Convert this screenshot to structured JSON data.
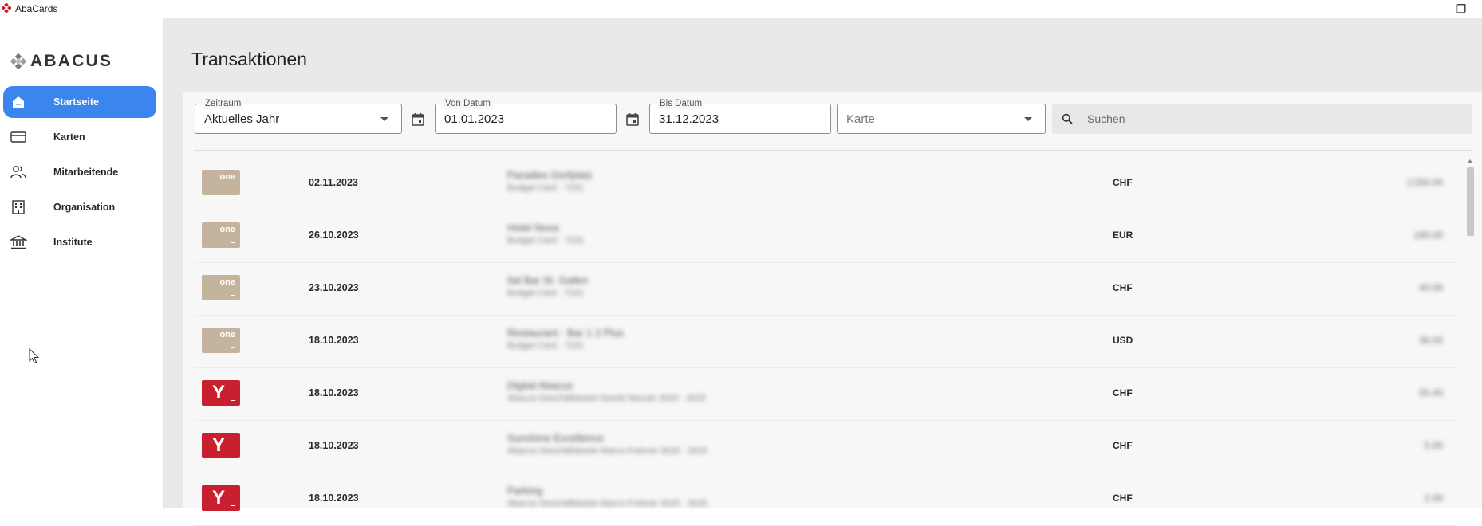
{
  "window": {
    "title": "AbaCards",
    "minimize_glyph": "–",
    "restore_glyph": "❐"
  },
  "sidebar": {
    "logo_text": "ABACUS",
    "items": [
      {
        "label": "Startseite",
        "icon": "home-icon",
        "active": true
      },
      {
        "label": "Karten",
        "icon": "card-icon",
        "active": false
      },
      {
        "label": "Mitarbeitende",
        "icon": "people-icon",
        "active": false
      },
      {
        "label": "Organisation",
        "icon": "building-icon",
        "active": false
      },
      {
        "label": "Institute",
        "icon": "bank-icon",
        "active": false
      }
    ]
  },
  "page": {
    "title": "Transaktionen"
  },
  "filters": {
    "zeitraum": {
      "label": "Zeitraum",
      "value": "Aktuelles Jahr"
    },
    "von_datum": {
      "label": "Von Datum",
      "value": "01.01.2023"
    },
    "bis_datum": {
      "label": "Bis Datum",
      "value": "31.12.2023"
    },
    "karte": {
      "placeholder": "Karte"
    },
    "search": {
      "placeholder": "Suchen"
    }
  },
  "card_labels": {
    "beige": "one",
    "red": "Y"
  },
  "transactions": [
    {
      "card": "beige",
      "date": "02.11.2023",
      "merchant": "Paradies Dorfplatz",
      "merchant_sub": "Budget Card · 7231",
      "currency": "CHF",
      "amount": "1'250.00"
    },
    {
      "card": "beige",
      "date": "26.10.2023",
      "merchant": "Hotel Nova",
      "merchant_sub": "Budget Card · 7231",
      "currency": "EUR",
      "amount": "180.00"
    },
    {
      "card": "beige",
      "date": "23.10.2023",
      "merchant": "Ital Bar St. Gallen",
      "merchant_sub": "Budget Card · 7231",
      "currency": "CHF",
      "amount": "40.00"
    },
    {
      "card": "beige",
      "date": "18.10.2023",
      "merchant": "Restaurant · Bar 1 2 Plus",
      "merchant_sub": "Budget Card · 7231",
      "currency": "USD",
      "amount": "36.00"
    },
    {
      "card": "red",
      "date": "18.10.2023",
      "merchant": "Digital Abacus",
      "merchant_sub": "Abacus Geschäftskarte Daniel Neuner 3020 · 3025",
      "currency": "CHF",
      "amount": "55.40"
    },
    {
      "card": "red",
      "date": "18.10.2023",
      "merchant": "Sunshine Excellence",
      "merchant_sub": "Abacus Geschäftskarte Marco Frehner 3020 · 3025",
      "currency": "CHF",
      "amount": "5.00"
    },
    {
      "card": "red",
      "date": "18.10.2023",
      "merchant": "Parking",
      "merchant_sub": "Abacus Geschäftskarte Marco Frehner 3020 · 3025",
      "currency": "CHF",
      "amount": "2.00"
    }
  ],
  "colors": {
    "accent": "#3a86ee",
    "card_beige": "#c4b39d",
    "card_red": "#c8202e"
  }
}
